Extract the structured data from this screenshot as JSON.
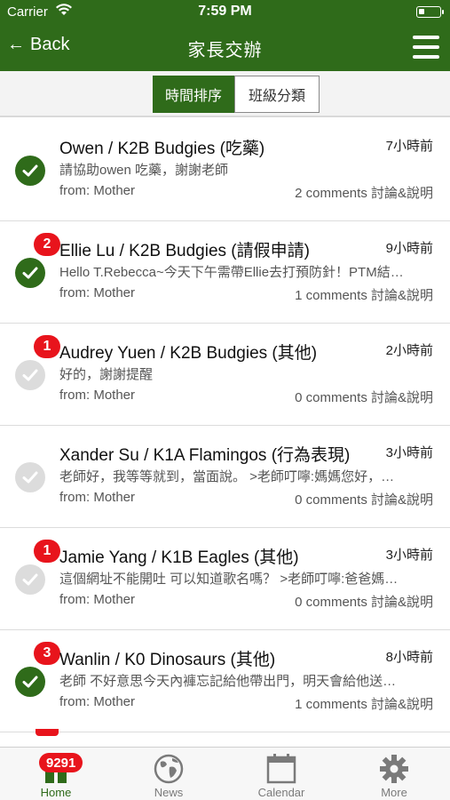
{
  "status_bar": {
    "carrier": "Carrier",
    "time": "7:59 PM",
    "battery_level": 0.25
  },
  "navbar": {
    "back_label": "Back",
    "title": "家長交辦"
  },
  "segments": {
    "active": "時間排序",
    "inactive": "班級分類"
  },
  "items": [
    {
      "title": "Owen / K2B Budgies (吃藥)",
      "time": "7小時前",
      "message": "請協助owen 吃藥，謝謝老師",
      "from": "from: Mother",
      "comments": "2 comments 討論&說明",
      "status": "done",
      "badge": ""
    },
    {
      "title": "Ellie Lu / K2B Budgies (請假申請)",
      "time": "9小時前",
      "message": "Hello T.Rebecca~今天下午需帶Ellie去打預防針！PTM結…",
      "from": "from: Mother",
      "comments": "1 comments 討論&說明",
      "status": "done",
      "badge": "2"
    },
    {
      "title": "Audrey Yuen / K2B Budgies (其他)",
      "time": "2小時前",
      "message": "好的，謝謝提醒",
      "from": "from: Mother",
      "comments": "0 comments 討論&說明",
      "status": "pending",
      "badge": "1"
    },
    {
      "title": "Xander Su / K1A Flamingos (行為表現)",
      "time": "3小時前",
      "message": "老師好，我等等就到，當面說。 >老師叮嚀:媽媽您好，…",
      "from": "from: Mother",
      "comments": "0 comments 討論&說明",
      "status": "pending",
      "badge": ""
    },
    {
      "title": "Jamie Yang / K1B Eagles (其他)",
      "time": "3小時前",
      "message": "這個網址不能開吐 可以知道歌名嗎？ >老師叮嚀:爸爸媽…",
      "from": "from: Mother",
      "comments": "0 comments 討論&說明",
      "status": "pending",
      "badge": "1"
    },
    {
      "title": "Wanlin / K0 Dinosaurs (其他)",
      "time": "8小時前",
      "message": "老師 不好意思今天內褲忘記給他帶出門，明天會給他送…",
      "from": "from: Mother",
      "comments": "1 comments 討論&說明",
      "status": "done",
      "badge": "3"
    }
  ],
  "tabbar": {
    "home_badge": "9291",
    "tabs": [
      "Home",
      "News",
      "Calendar",
      "More"
    ]
  },
  "colors": {
    "primary": "#2f6b1a",
    "badge": "#e8141c",
    "pending": "#dcdcdc"
  }
}
